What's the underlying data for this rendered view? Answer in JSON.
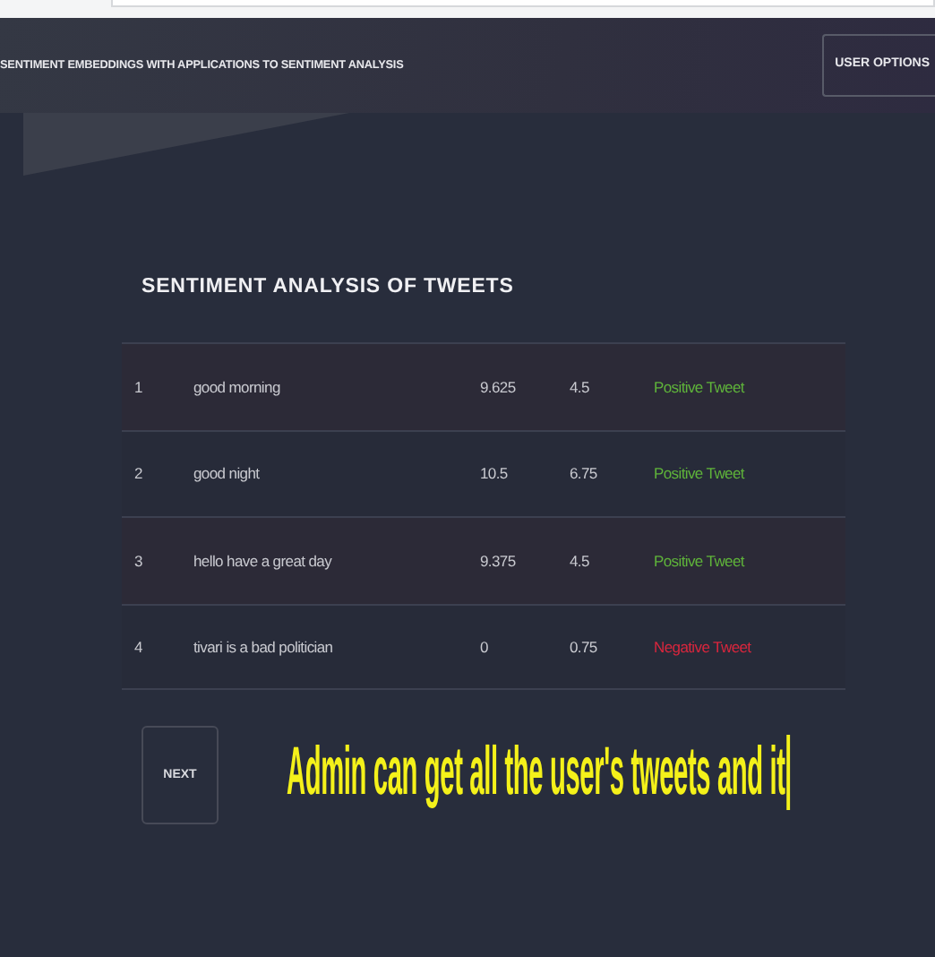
{
  "header": {
    "title": "SENTIMENT EMBEDDINGS WITH APPLICATIONS TO SENTIMENT ANALYSIS",
    "user_button": "USER OPTIONS"
  },
  "heading": "SENTIMENT ANALYSIS OF TWEETS",
  "table": {
    "rows": [
      {
        "index": "1",
        "tweet": "good morning",
        "score_1": "9.625",
        "score_2": "4.5",
        "label": "Positive Tweet",
        "color": "#5fb43a"
      },
      {
        "index": "2",
        "tweet": "good night",
        "score_1": "10.5",
        "score_2": "6.75",
        "label": "Positive Tweet",
        "color": "#5fb43a"
      },
      {
        "index": "3",
        "tweet": "hello have a great day",
        "score_1": "9.375",
        "score_2": "4.5",
        "label": "Positive Tweet",
        "color": "#5fb43a"
      },
      {
        "index": "4",
        "tweet": "tivari is a bad politician",
        "score_1": "0",
        "score_2": "0.75",
        "label": "Negative Tweet",
        "color": "#d9263d"
      }
    ]
  },
  "next_button": "NEXT",
  "caption": "Admin can get all the user's tweets and it"
}
